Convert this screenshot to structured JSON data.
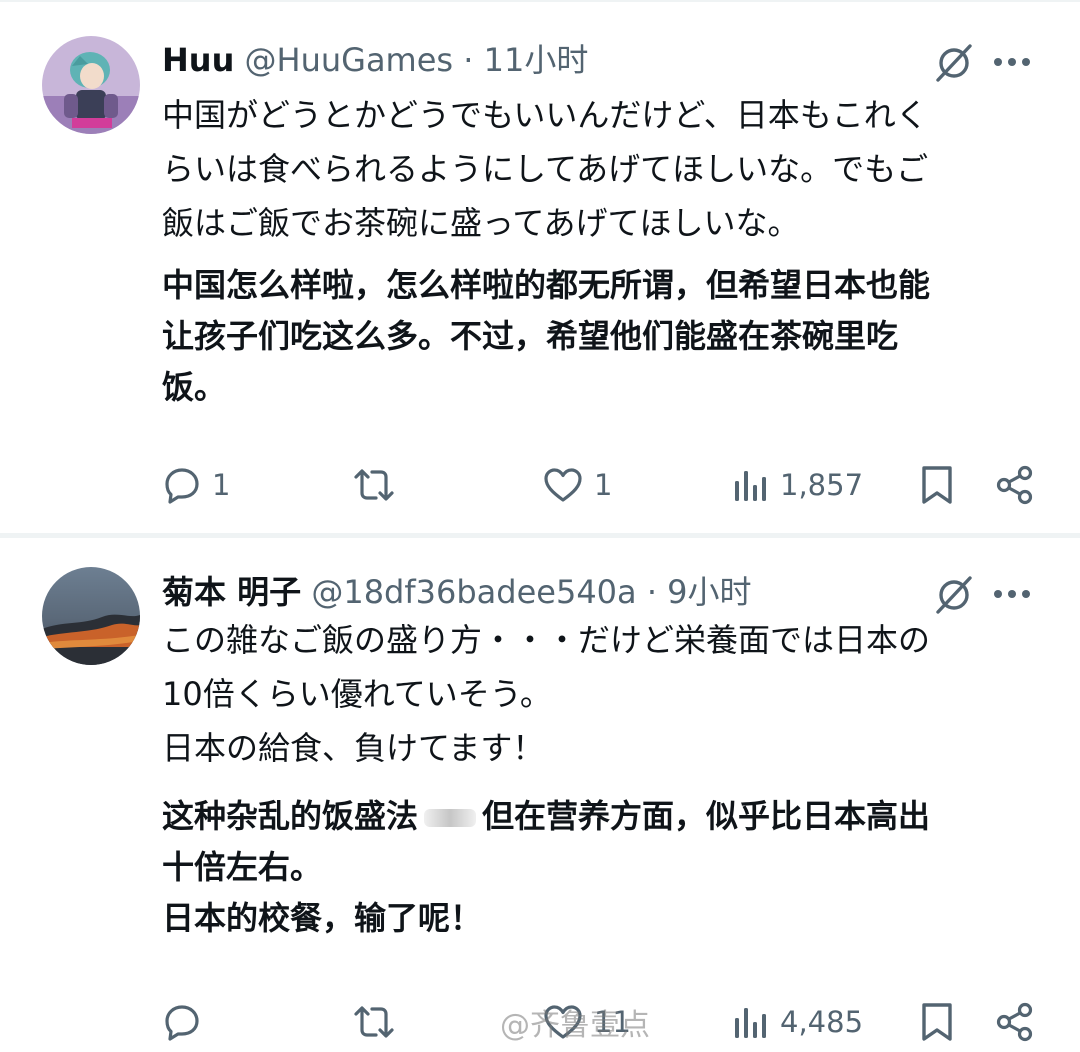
{
  "tweets": [
    {
      "name": "Huu",
      "handle": "@HuuGames",
      "separator": "·",
      "time": "11小时",
      "text_lines": [
        "中国がどうとかどうでもいいんだけど、日本もこれく",
        "らいは食べられるようにしてあげてほしいな。でもご",
        "飯はご飯でお茶碗に盛ってあげてほしいな。"
      ],
      "translation_lines": [
        "中国怎么样啦，怎么样啦的都无所谓，但希望日本也能",
        "让孩子们吃这么多。不过，希望他们能盛在茶碗里吃",
        "饭。"
      ],
      "stats": {
        "replies": "1",
        "reposts": "",
        "likes": "1",
        "views": "1,857"
      }
    },
    {
      "name": "菊本 明子",
      "handle": "@18df36badee540a",
      "separator": "·",
      "time": "9小时",
      "text_lines": [
        "この雑なご飯の盛り方・・・だけど栄養面では日本の",
        "10倍くらい優れていそう。",
        "日本の給食、負けてます！"
      ],
      "translation_lines_parts": {
        "before": "这种杂乱的饭盛法",
        "after": "但在营养方面，似乎比日本高出"
      },
      "translation_lines": [
        "十倍左右。",
        "日本的校餐，输了呢！"
      ],
      "stats": {
        "replies": "",
        "reposts": "",
        "likes": "11",
        "views": "4,485"
      }
    }
  ],
  "icons": {
    "reply": "reply-icon",
    "repost": "repost-icon",
    "like": "heart-icon",
    "views": "views-icon",
    "bookmark": "bookmark-icon",
    "share": "share-icon",
    "grok": "grok-icon",
    "more": "more-icon"
  },
  "colors": {
    "text": "#0f1419",
    "secondary": "#536471",
    "divider": "#eff3f4",
    "background": "#ffffff"
  },
  "watermark": "@齐鲁壹点"
}
